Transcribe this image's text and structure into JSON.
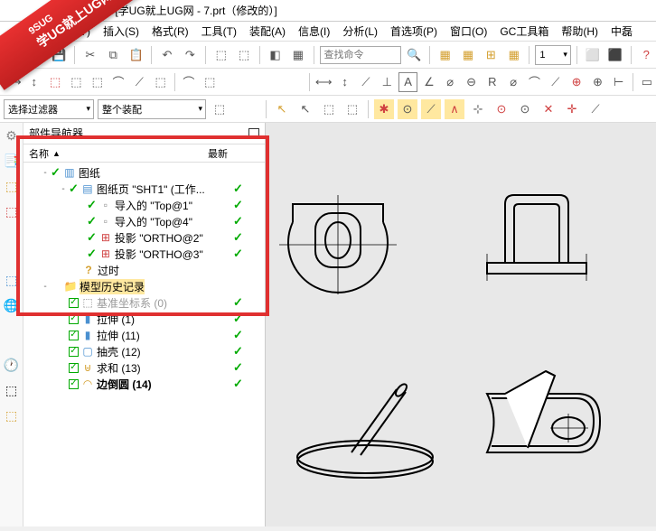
{
  "title": "- [学UG就上UG网 - 7.prt（修改的）]",
  "watermark": {
    "line1": "9SUG",
    "line2": "学UG就上UG网"
  },
  "menu": [
    "视图(V)",
    "插入(S)",
    "格式(R)",
    "工具(T)",
    "装配(A)",
    "信息(I)",
    "分析(L)",
    "首选项(P)",
    "窗口(O)",
    "GC工具箱",
    "帮助(H)",
    "中磊"
  ],
  "search_placeholder": "查找命令",
  "filter_combo": "选择过滤器",
  "assembly_combo": "整个装配",
  "num_combo": "1",
  "nav": {
    "title": "部件导航器",
    "col1": "名称",
    "col2": "最新",
    "sort": "▲"
  },
  "tree": [
    {
      "ind": 0,
      "exp": "-",
      "chk": true,
      "icon": "drawing",
      "txt": "图纸",
      "latest": false,
      "bold": false
    },
    {
      "ind": 1,
      "exp": "-",
      "chk": true,
      "icon": "sheet",
      "txt": "图纸页 \"SHT1\" (工作...",
      "latest": true,
      "bold": false
    },
    {
      "ind": 2,
      "exp": "",
      "chk": true,
      "icon": "import",
      "txt": "导入的 \"Top@1\"",
      "latest": true,
      "bold": false
    },
    {
      "ind": 2,
      "exp": "",
      "chk": true,
      "icon": "import",
      "txt": "导入的 \"Top@4\"",
      "latest": true,
      "bold": false
    },
    {
      "ind": 2,
      "exp": "",
      "chk": true,
      "icon": "proj",
      "txt": "投影 \"ORTHO@2\"",
      "latest": true,
      "bold": false
    },
    {
      "ind": 2,
      "exp": "",
      "chk": true,
      "icon": "proj",
      "txt": "投影 \"ORTHO@3\"",
      "latest": true,
      "bold": false
    },
    {
      "ind": 1,
      "exp": "",
      "chk": false,
      "icon": "warn",
      "txt": "过时",
      "latest": false,
      "bold": false
    },
    {
      "ind": 0,
      "exp": "-",
      "chk": false,
      "icon": "folder",
      "txt": "模型历史记录",
      "latest": false,
      "bold": false,
      "dim": true
    },
    {
      "ind": 1,
      "exp": "",
      "chk": true,
      "chkbox": true,
      "icon": "csys",
      "txt": "基准坐标系 (0)",
      "latest": true,
      "bold": false,
      "grey": true
    },
    {
      "ind": 1,
      "exp": "",
      "chk": true,
      "chkbox": true,
      "icon": "extrude",
      "txt": "拉伸 (1)",
      "latest": true,
      "bold": false
    },
    {
      "ind": 1,
      "exp": "",
      "chk": true,
      "chkbox": true,
      "icon": "extrude",
      "txt": "拉伸 (11)",
      "latest": true,
      "bold": false
    },
    {
      "ind": 1,
      "exp": "",
      "chk": true,
      "chkbox": true,
      "icon": "shell",
      "txt": "抽壳 (12)",
      "latest": true,
      "bold": false
    },
    {
      "ind": 1,
      "exp": "",
      "chk": true,
      "chkbox": true,
      "icon": "sum",
      "txt": "求和 (13)",
      "latest": true,
      "bold": false
    },
    {
      "ind": 1,
      "exp": "",
      "chk": true,
      "chkbox": true,
      "icon": "chamfer",
      "txt": "边倒圆 (14)",
      "latest": true,
      "bold": true
    }
  ]
}
